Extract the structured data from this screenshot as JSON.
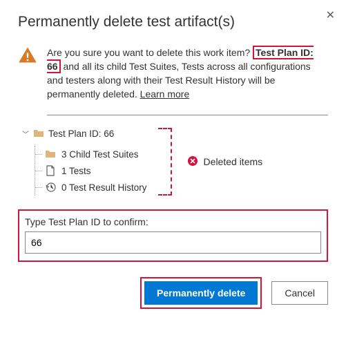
{
  "title": "Permanently delete test artifact(s)",
  "message": {
    "before": "Are you sure you want to delete this work item?",
    "highlight": "Test Plan ID: 66",
    "after": "and all its child Test Suites, Tests across all configurations and testers along with their Test Result History will be permanently deleted.",
    "learn_more": "Learn more"
  },
  "tree": {
    "root": "Test Plan ID: 66",
    "children": [
      "3 Child Test Suites",
      "1 Tests",
      "0 Test Result History"
    ]
  },
  "deleted_label": "Deleted items",
  "confirm": {
    "label": "Type Test Plan ID to confirm:",
    "value": "66"
  },
  "buttons": {
    "primary": "Permanently delete",
    "cancel": "Cancel"
  }
}
